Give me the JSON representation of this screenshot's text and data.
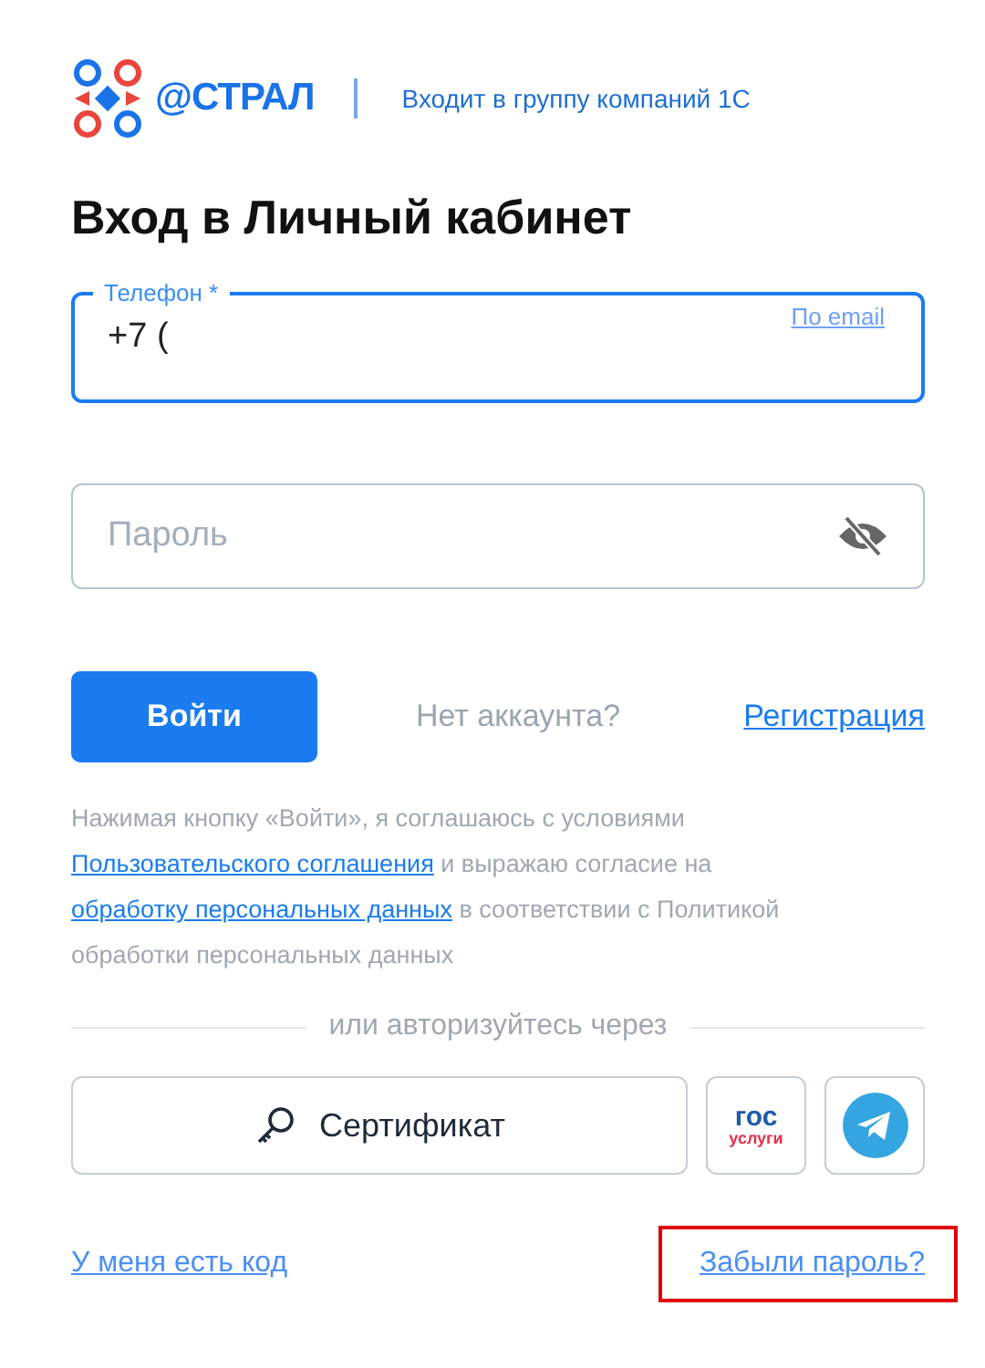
{
  "header": {
    "brand": "@СТРАЛ",
    "tagline": "Входит в группу компаний 1С"
  },
  "title": "Вход в Личный кабинет",
  "phone_field": {
    "label": "Телефон *",
    "value": "+7 (",
    "switch_link": "По email",
    "focused": true
  },
  "password_field": {
    "placeholder": "Пароль",
    "visible": false
  },
  "login_button": "Войти",
  "no_account": "Нет аккаунта?",
  "register_link": "Регистрация",
  "consent": {
    "before": "Нажимая кнопку «Войти», я соглашаюсь с условиями",
    "agreement_link": "Пользовательского соглашения",
    "middle": "и выражаю согласие на",
    "data_link": "обработку персональных данных",
    "after": "в соответствии с Политикой обработки персональных данных"
  },
  "divider_text": "или авторизуйтесь через",
  "alt_logins": [
    {
      "kind": "certificate",
      "label": "Сертификат"
    },
    {
      "kind": "gosuslugi",
      "top": "гос",
      "bottom": "услуги"
    },
    {
      "kind": "telegram"
    }
  ],
  "bottom_links": [
    {
      "label": "У меня есть код",
      "highlighted": false
    },
    {
      "label": "Забыли пароль?",
      "highlighted": true
    }
  ]
}
